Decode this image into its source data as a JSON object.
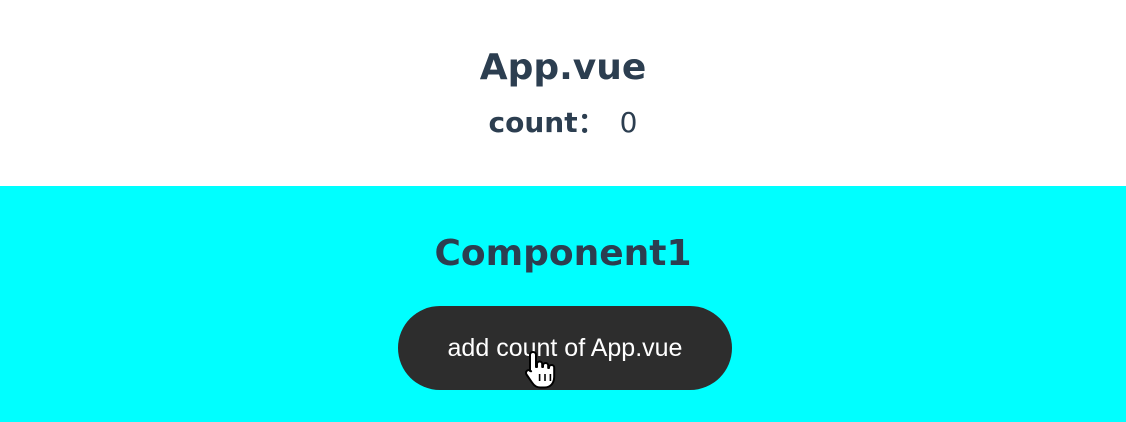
{
  "app": {
    "title": "App.vue",
    "count_label": "count：",
    "count_value": "0"
  },
  "component1": {
    "title": "Component1",
    "button_label": "add count of App.vue",
    "background_color": "#00ffff",
    "button_color": "#2d2d2d"
  },
  "cursor": {
    "icon": "pointer-hand-icon"
  }
}
